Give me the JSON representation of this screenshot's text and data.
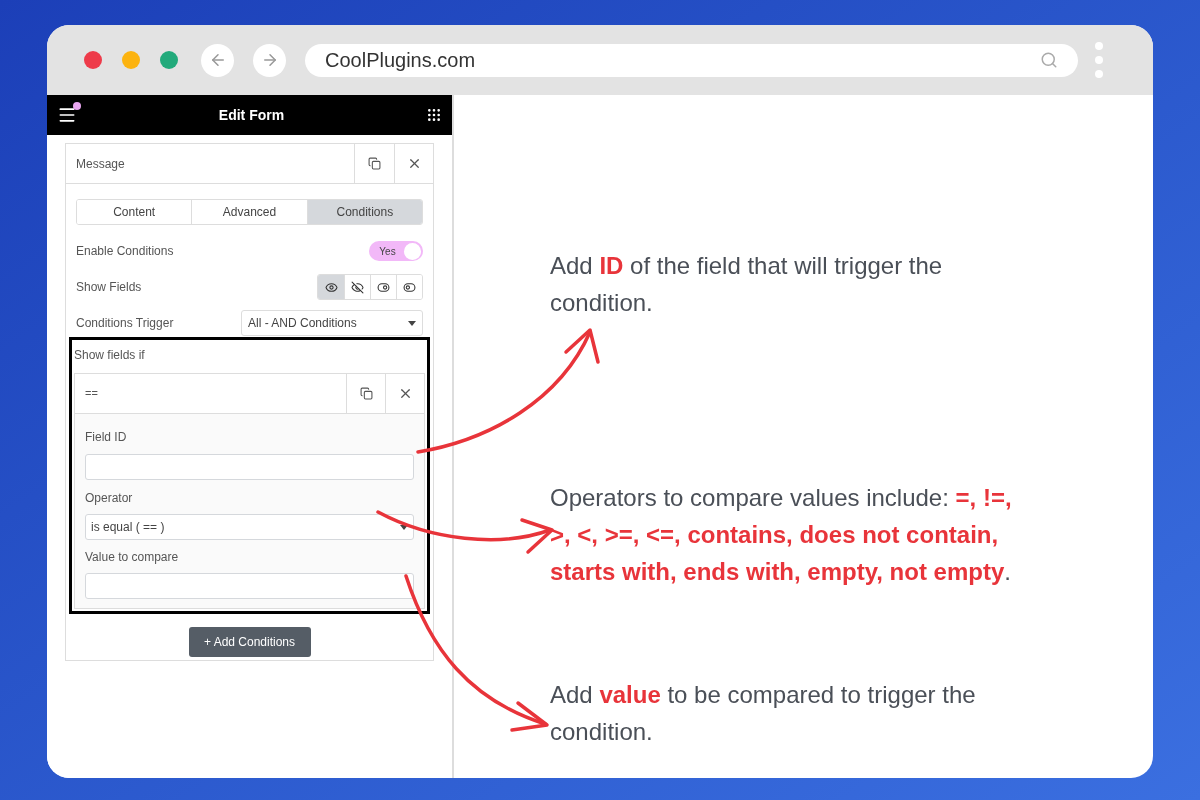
{
  "browser": {
    "url": "CoolPlugins.com"
  },
  "editor": {
    "title": "Edit Form",
    "notification_dot": true,
    "widget": {
      "title": "Message",
      "tabs": [
        {
          "label": "Content",
          "selected": false
        },
        {
          "label": "Advanced",
          "selected": false
        },
        {
          "label": "Conditions",
          "selected": true
        }
      ],
      "enable_conditions": {
        "label": "Enable Conditions",
        "on": true,
        "toggle_text": "Yes"
      },
      "show_fields": {
        "label": "Show Fields",
        "options": [
          {
            "kind": "show",
            "selected": true
          },
          {
            "kind": "hide",
            "selected": false
          },
          {
            "kind": "toggle-on",
            "selected": false
          },
          {
            "kind": "toggle-off",
            "selected": false
          }
        ]
      },
      "conditions_trigger": {
        "label": "Conditions Trigger",
        "value": "All - AND Conditions"
      },
      "show_fields_if": {
        "label": "Show fields if",
        "item_title": "==",
        "field_id": {
          "label": "Field ID"
        },
        "operator": {
          "label": "Operator",
          "value": "is equal ( == )"
        },
        "value_to_compare": {
          "label": "Value to compare"
        }
      },
      "add_button": "+ Add Conditions"
    }
  },
  "annotations": [
    {
      "text": "Add **ID** of the field that will trigger the condition."
    },
    {
      "text": "Operators to compare values include: **=, !=, >, <, >=, <=, contains, does not contain, starts with, ends with, empty, not empty**."
    },
    {
      "text": "Add **value** to be compared to trigger the condition."
    }
  ]
}
